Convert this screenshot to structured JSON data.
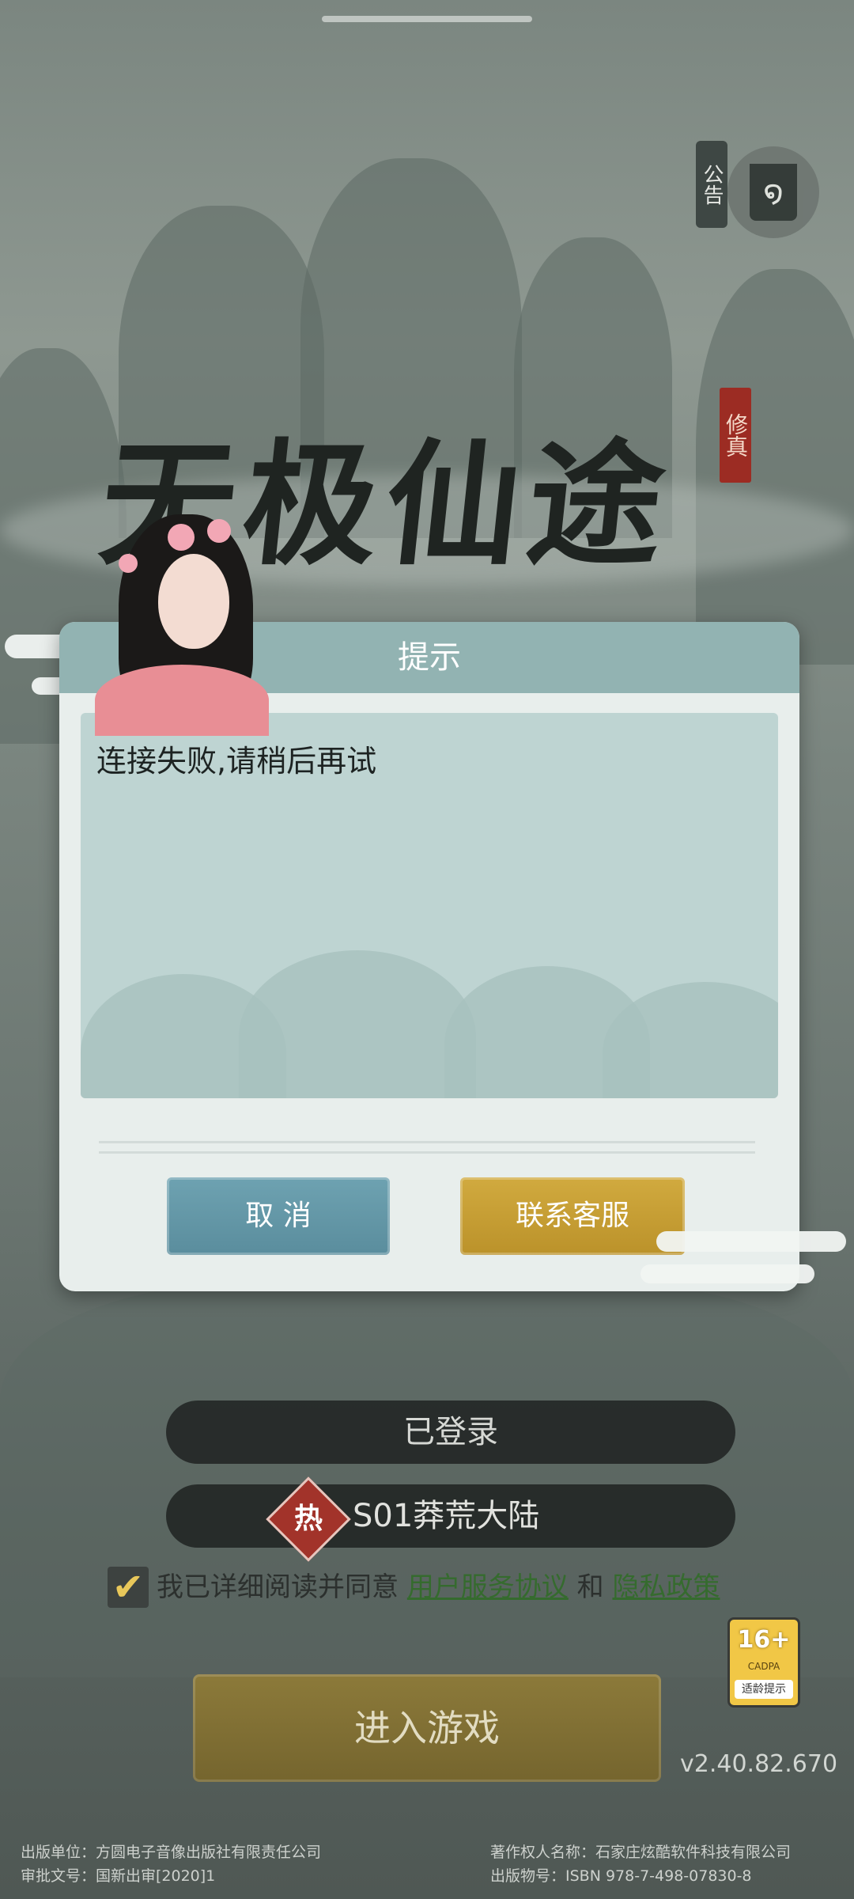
{
  "notice": {
    "label": "公告",
    "emblem_icon": "spiral-icon"
  },
  "game": {
    "title": "无极仙途",
    "seal": "修真"
  },
  "dialog": {
    "title": "提示",
    "message": "连接失败,请稍后再试",
    "cancel_label": "取 消",
    "service_label": "联系客服"
  },
  "login": {
    "status": "已登录"
  },
  "server": {
    "badge": "热",
    "name": "S01莽荒大陆"
  },
  "agreement": {
    "checked": true,
    "prefix": "我已详细阅读并同意",
    "user_agreement": "用户服务协议",
    "and": "和",
    "privacy": "隐私政策"
  },
  "age_rating": {
    "age": "16+",
    "org": "CADPA",
    "tip": "适龄提示"
  },
  "enter_label": "进入游戏",
  "version": "v2.40.82.670",
  "footer": {
    "publisher": "出版单位：方圆电子音像出版社有限责任公司",
    "approval": "审批文号：国新出审[2020]1",
    "copyright_owner": "著作权人名称：石家庄炫酷软件科技有限公司",
    "isbn": "出版物号：ISBN 978-7-498-07830-8"
  },
  "colors": {
    "dialog_header": "#92b3b2",
    "cancel_button": "#5f93a3",
    "service_button": "#c39b32",
    "enter_button": "#807036",
    "hot_badge": "#a2332a",
    "link": "#356b2e"
  }
}
